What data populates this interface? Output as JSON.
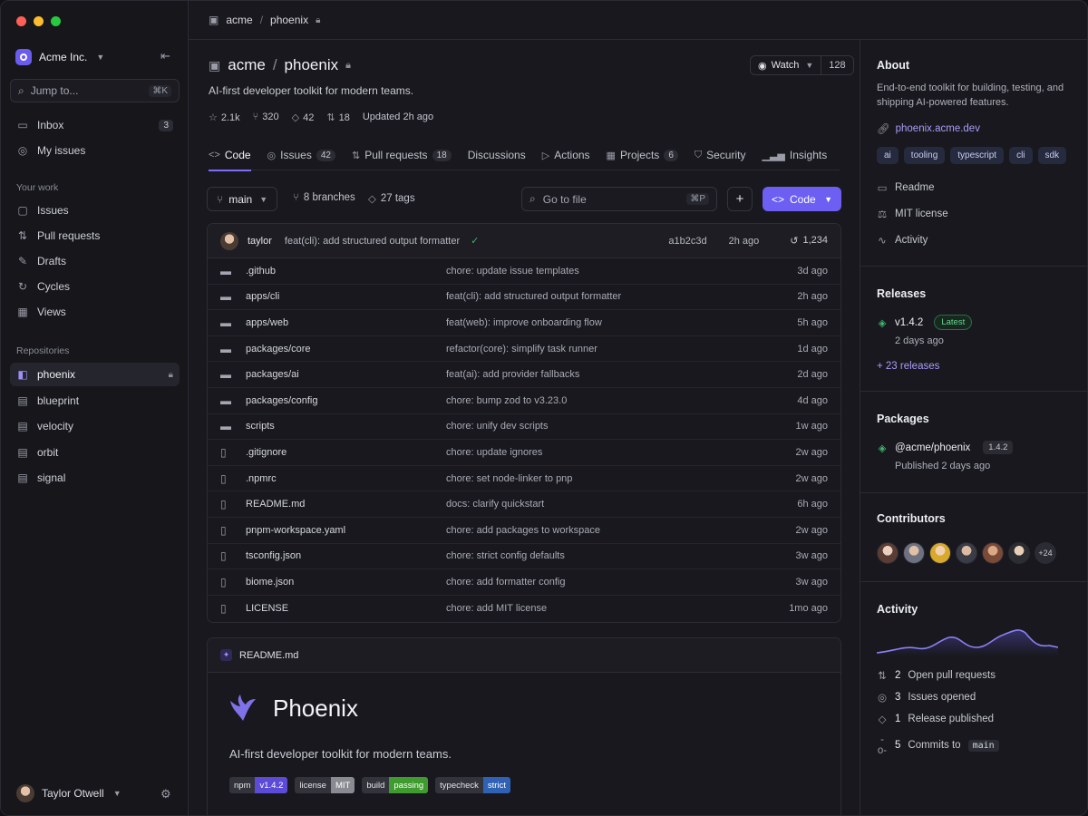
{
  "sidebar": {
    "org_name": "Acme Inc.",
    "jump_placeholder": "Jump to...",
    "jump_shortcut": "⌘K",
    "top_items": [
      {
        "label": "Inbox",
        "count": "3",
        "icon": "inbox-icon"
      },
      {
        "label": "My issues",
        "icon": "issue-icon"
      }
    ],
    "your_work_label": "Your work",
    "work_items": [
      {
        "label": "Issues",
        "icon": "issues-icon"
      },
      {
        "label": "Pull requests",
        "icon": "pull-request-icon"
      },
      {
        "label": "Drafts",
        "icon": "pencil-icon"
      },
      {
        "label": "Cycles",
        "icon": "cycle-icon"
      },
      {
        "label": "Views",
        "icon": "grid-icon"
      }
    ],
    "repositories_label": "Repositories",
    "repos": [
      "phoenix",
      "blueprint",
      "velocity",
      "orbit",
      "signal"
    ],
    "user_name": "Taylor Otwell"
  },
  "breadcrumb": {
    "org": "acme",
    "repo": "phoenix"
  },
  "repo": {
    "owner": "acme",
    "name": "phoenix",
    "description": "AI-first developer toolkit for modern teams.",
    "stars": "2.1k",
    "forks": "320",
    "tags_count": "42",
    "prs_count": "18",
    "updated": "Updated 2h ago",
    "watch_label": "Watch",
    "watch_count": "128"
  },
  "tabs": [
    {
      "label": "Code",
      "icon": "code-icon",
      "active": true
    },
    {
      "label": "Issues",
      "icon": "issue-icon",
      "badge": "42"
    },
    {
      "label": "Pull requests",
      "icon": "pull-request-icon",
      "badge": "18"
    },
    {
      "label": "Discussions",
      "icon": ""
    },
    {
      "label": "Actions",
      "icon": "play-icon"
    },
    {
      "label": "Projects",
      "icon": "table-icon",
      "badge": "6"
    },
    {
      "label": "Security",
      "icon": "shield-icon"
    },
    {
      "label": "Insights",
      "icon": "chart-icon"
    }
  ],
  "toolbar": {
    "branch": "main",
    "branches": "8 branches",
    "tags": "27 tags",
    "gofile_placeholder": "Go to file",
    "gofile_shortcut": "⌘P",
    "code_label": "Code"
  },
  "last_commit": {
    "author": "taylor",
    "message": "feat(cli): add structured output formatter",
    "hash": "a1b2c3d",
    "time": "2h ago",
    "total_commits": "1,234"
  },
  "files": [
    {
      "type": "folder",
      "name": ".github",
      "message": "chore: update issue templates",
      "date": "3d ago"
    },
    {
      "type": "folder",
      "name": "apps/cli",
      "message": "feat(cli): add structured output formatter",
      "date": "2h ago"
    },
    {
      "type": "folder",
      "name": "apps/web",
      "message": "feat(web): improve onboarding flow",
      "date": "5h ago"
    },
    {
      "type": "folder",
      "name": "packages/core",
      "message": "refactor(core): simplify task runner",
      "date": "1d ago"
    },
    {
      "type": "folder",
      "name": "packages/ai",
      "message": "feat(ai): add provider fallbacks",
      "date": "2d ago"
    },
    {
      "type": "folder",
      "name": "packages/config",
      "message": "chore: bump zod to v3.23.0",
      "date": "4d ago"
    },
    {
      "type": "folder",
      "name": "scripts",
      "message": "chore: unify dev scripts",
      "date": "1w ago"
    },
    {
      "type": "file",
      "name": ".gitignore",
      "message": "chore: update ignores",
      "date": "2w ago"
    },
    {
      "type": "file",
      "name": ".npmrc",
      "message": "chore: set node-linker to pnp",
      "date": "2w ago"
    },
    {
      "type": "file",
      "name": "README.md",
      "message": "docs: clarify quickstart",
      "date": "6h ago"
    },
    {
      "type": "file",
      "name": "pnpm-workspace.yaml",
      "message": "chore: add packages to workspace",
      "date": "2w ago"
    },
    {
      "type": "file",
      "name": "tsconfig.json",
      "message": "chore: strict config defaults",
      "date": "3w ago"
    },
    {
      "type": "file",
      "name": "biome.json",
      "message": "chore: add formatter config",
      "date": "3w ago"
    },
    {
      "type": "file",
      "name": "LICENSE",
      "message": "chore: add MIT license",
      "date": "1mo ago"
    }
  ],
  "readme": {
    "filename": "README.md",
    "title": "Phoenix",
    "description": "AI-first developer toolkit for modern teams.",
    "badges": [
      {
        "label": "npm",
        "value": "v1.4.2",
        "color": "#5b4bd6"
      },
      {
        "label": "license",
        "value": "MIT",
        "color": "#8a8b92"
      },
      {
        "label": "build",
        "value": "passing",
        "color": "#3f9b2f"
      },
      {
        "label": "typecheck",
        "value": "strict",
        "color": "#2f62b5"
      }
    ]
  },
  "about": {
    "heading": "About",
    "description": "End-to-end toolkit for building, testing, and shipping AI-powered features.",
    "website": "phoenix.acme.dev",
    "topics": [
      "ai",
      "tooling",
      "typescript",
      "cli",
      "sdk"
    ],
    "links": [
      "Readme",
      "MIT license",
      "Activity"
    ]
  },
  "releases": {
    "heading": "Releases",
    "version": "v1.4.2",
    "badge": "Latest",
    "date": "2 days ago",
    "more": "+ 23 releases"
  },
  "packages": {
    "heading": "Packages",
    "name": "@acme/phoenix",
    "version": "1.4.2",
    "published": "Published 2 days ago"
  },
  "contributors": {
    "heading": "Contributors",
    "more": "+24"
  },
  "activity": {
    "heading": "Activity",
    "items": [
      {
        "count": "2",
        "label": "Open pull requests",
        "icon": "pull-request-icon"
      },
      {
        "count": "3",
        "label": "Issues opened",
        "icon": "issue-icon"
      },
      {
        "count": "1",
        "label": "Release published",
        "icon": "tag-icon"
      },
      {
        "count": "5",
        "label": "Commits to",
        "branch": "main",
        "icon": "commit-icon"
      }
    ]
  },
  "colors": {
    "accent": "#6c5ff2",
    "link": "#a99df8",
    "success": "#3fb36b"
  }
}
